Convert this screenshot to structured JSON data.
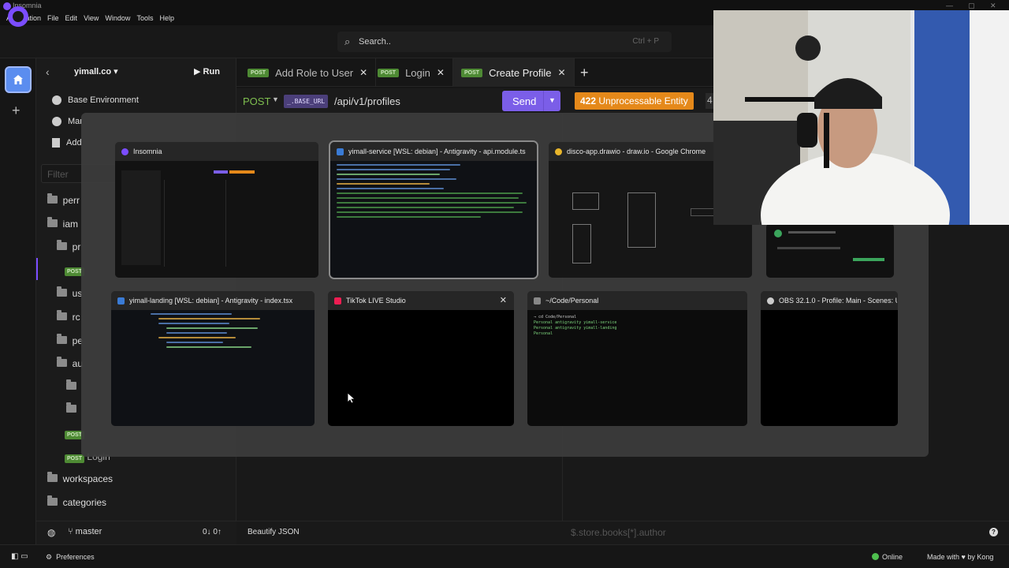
{
  "window": {
    "title": "Insomnia"
  },
  "menu": [
    "Application",
    "File",
    "Edit",
    "View",
    "Window",
    "Tools",
    "Help"
  ],
  "search": {
    "placeholder": "Search..",
    "shortcut": "Ctrl + P"
  },
  "sidebar": {
    "workspace": "yimall.co",
    "run_label": "Run",
    "env_items": [
      "Base Environment",
      "Mar",
      "Add"
    ],
    "filter_placeholder": "Filter",
    "tree": [
      {
        "label": "perr",
        "kind": "folder"
      },
      {
        "label": "iam",
        "kind": "folder"
      },
      {
        "label": "pr",
        "kind": "folder"
      },
      {
        "label": "POST",
        "kind": "request"
      },
      {
        "label": "us",
        "kind": "folder"
      },
      {
        "label": "rc",
        "kind": "folder"
      },
      {
        "label": "pe",
        "kind": "folder"
      },
      {
        "label": "au",
        "kind": "folder"
      },
      {
        "label": "",
        "kind": "folder"
      },
      {
        "label": "",
        "kind": "folder"
      },
      {
        "label": "POST",
        "kind": "request"
      },
      {
        "label": "Login",
        "kind": "request",
        "method": "POST"
      },
      {
        "label": "workspaces",
        "kind": "folder"
      },
      {
        "label": "categories",
        "kind": "folder"
      }
    ],
    "git_branch": "master",
    "git_counts": "0↓ 0↑"
  },
  "tabs": [
    {
      "method": "POST",
      "label": "Add Role to User",
      "active": false
    },
    {
      "method": "POST",
      "label": "Login",
      "active": false
    },
    {
      "method": "POST",
      "label": "Create Profile",
      "active": true
    }
  ],
  "request": {
    "method": "POST",
    "base_url_tag": "_.BASE_URL",
    "path": "/api/v1/profiles",
    "send_label": "Send",
    "status_code": "422",
    "status_text": "Unprocessable Entity",
    "status_extra": "4"
  },
  "bottom": {
    "beautify": "Beautify JSON",
    "jsonpath_placeholder": "$.store.books[*].author"
  },
  "statusbar": {
    "preferences": "Preferences",
    "online": "Online",
    "made_with": "Made with",
    "by": "by Kong"
  },
  "switcher": {
    "windows": [
      {
        "title": "Insomnia",
        "icon_color": "#7b4dff"
      },
      {
        "title": "yimall-service [WSL: debian] - Antigravity - api.module.ts",
        "icon_color": "#3a7bd5"
      },
      {
        "title": "disco-app.drawio - draw.io - Google Chrome",
        "icon_color": "#e9b62b"
      },
      {
        "title": "yimall-landing [WSL: debian] - Antigravity - index.tsx",
        "icon_color": "#3a7bd5"
      },
      {
        "title": "TikTok LIVE Studio",
        "icon_color": "#ee1d52",
        "close": "✕"
      },
      {
        "title": "~/Code/Personal",
        "icon_color": "#888888"
      },
      {
        "title": "OBS 32.1.0 - Profile: Main - Scenes: Un...",
        "icon_color": "#cccccc"
      }
    ]
  },
  "terminal_preview": [
    "→ cd Code/Personal",
    "Personal antigravity yimall-service",
    "Personal antigravity yimall-landing",
    "Personal"
  ],
  "colors": {
    "accent": "#7b4dff",
    "post": "#4e8a34",
    "status": "#e5891a",
    "send": "#7b5ee8"
  }
}
